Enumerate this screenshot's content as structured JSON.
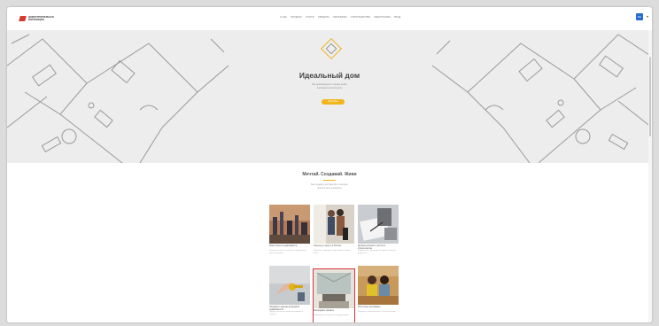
{
  "header": {
    "logo_text": "ДОМОСТРОИТЕЛЬНАЯ КОРПОРАЦИЯ",
    "nav": [
      "О НАС",
      "ПРОЕКТЫ",
      "УСЛУГИ",
      "ОБЪЕКТЫ",
      "ПАРТНЕРАМ",
      "СТРОИТЕЛЬСТВО",
      "ЭЛЕКТРОНИКА",
      "ВХОД"
    ],
    "lang_label": "RU",
    "caret": "▾"
  },
  "hero": {
    "title": "Идеальный дом",
    "subtitle_line1": "Мы проектируем и строим дома,",
    "subtitle_line2": "в которых хочется жить",
    "button": "Подробнее"
  },
  "section": {
    "title": "Мечтай. Создавай. Живи",
    "sub_line1": "Мы создаем пространства, в которых",
    "sub_line2": "приятно жить и работать"
  },
  "cards": [
    {
      "title": "Инвестиции в недвижимость",
      "desc": "Надежные вложения в объекты недвижимости с гарантией дохода"
    },
    {
      "title": "Переезд в город и в Россию",
      "desc": "Помогаем с переездом и адаптацией на новом месте"
    },
    {
      "title": "Договор долевого участия в строительстве",
      "desc": "Юридическое сопровождение сделок и проверка документов"
    },
    {
      "title": "Продажа и аренда загородной недвижимости",
      "desc": "Подбор объектов по вашим требованиям и бюджету"
    },
    {
      "title": "Загородные проекты",
      "desc": "Индивидуальные проекты загородных домов"
    },
    {
      "title": "Ипотечные программы",
      "desc": "Выгодные условия ипотеки от банков-партнеров"
    }
  ],
  "colors": {
    "accent": "#f0b51a",
    "selected": "#d9333a",
    "link": "#2a6bd1"
  }
}
